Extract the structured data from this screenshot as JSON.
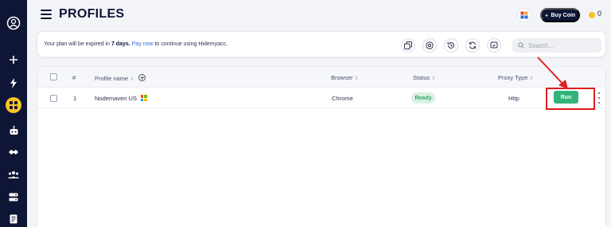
{
  "header": {
    "title": "PROFILES",
    "buy_coin_label": "Buy Coin",
    "coin_count": "0"
  },
  "notice": {
    "prefix": "Your plan will be expired in ",
    "days": "7 days.",
    "link": "Pay now",
    "suffix": " to continue using Hidemyacc."
  },
  "search": {
    "placeholder": "Search..."
  },
  "table": {
    "columns": {
      "index": "#",
      "name": "Profile name",
      "browser": "Browser",
      "status": "Status",
      "proxy": "Proxy Type"
    },
    "rows": [
      {
        "index": "1",
        "name": "Nodemaven US",
        "browser": "Chrome",
        "status": "Ready",
        "proxy": "Http",
        "action": "Run"
      }
    ]
  },
  "colors": {
    "sidebar": "#0f1535",
    "accent": "#f7c325",
    "run": "#31b37a",
    "link": "#2b6de0",
    "annotation": "#e02020"
  }
}
